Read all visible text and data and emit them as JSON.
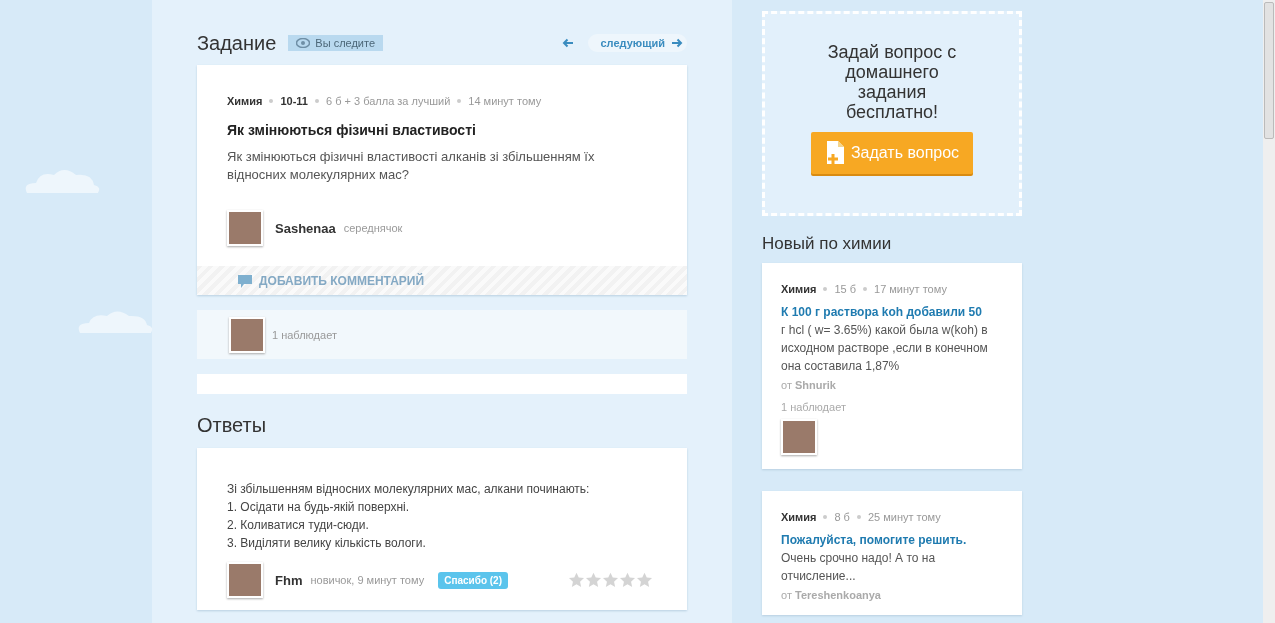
{
  "task": {
    "heading": "Задание",
    "follow_badge": "Вы следите",
    "next_label": "следующий",
    "subject": "Химия",
    "grade": "10-11",
    "points": "6 б + 3 балла за лучший",
    "time": "14 минут тому",
    "title": "Як змінюються фізичні властивості",
    "body": "Як змінюються фізичні властивості алканів зі збільшенням їх відносних молекулярних мас?",
    "author": {
      "name": "Sashenaa",
      "rank": "середнячок"
    },
    "comment_action": "ДОБАВИТЬ КОММЕНТАРИЙ",
    "watchers": "1 наблюдает"
  },
  "answers": {
    "heading": "Ответы",
    "items": [
      {
        "lines": [
          "Зі збільшенням відносних молекулярних мас, алкани починають:",
          "1. Осідати на будь-якій поверхні.",
          "2. Коливатися туди-сюди.",
          "3. Виділяти велику кількість вологи."
        ],
        "author": "Fhm",
        "meta": "новичок, 9 минут тому",
        "thanks": "Спасибо (2)",
        "stars": 0
      }
    ]
  },
  "sidebar": {
    "ask_title": "Задай вопрос с домашнего задания бесплатно!",
    "ask_button": "Задать вопрос",
    "new_heading": "Новый по химии",
    "questions": [
      {
        "subject": "Химия",
        "points": "15 б",
        "time": "17 минут тому",
        "title": "К 100 г раствора koh добавили 50",
        "body": "г hcl ( w= 3.65%) какой была w(koh) в исходном растворе ,если в конечном она составила 1,87%",
        "author": "от **Shnurik**",
        "watchers": "1 наблюдает"
      },
      {
        "subject": "Химия",
        "points": "8 б",
        "time": "25 минут тому",
        "title": "Пожалуйста, помогите решить.",
        "body": "Очень срочно надо! А то на отчисление...",
        "author": "от **Tereshenkoanya**"
      }
    ]
  }
}
